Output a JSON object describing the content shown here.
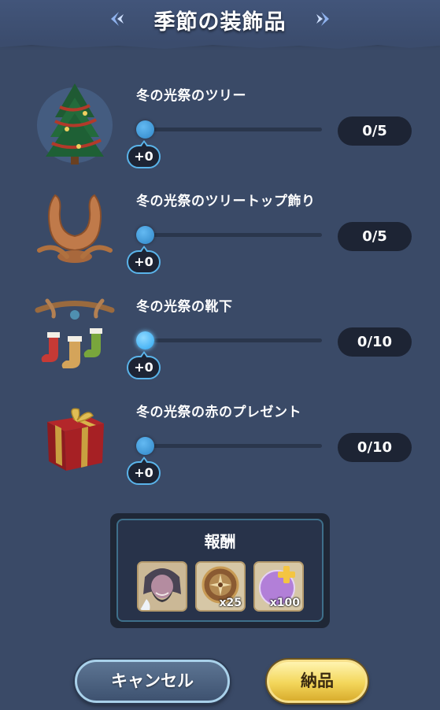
{
  "header": {
    "title": "季節の装飾品"
  },
  "items": [
    {
      "name": "冬の光祭のツリー",
      "bubble": "+0",
      "count": "0/5",
      "icon": "christmas-tree-icon"
    },
    {
      "name": "冬の光祭のツリートップ飾り",
      "bubble": "+0",
      "count": "0/5",
      "icon": "antler-ornament-icon"
    },
    {
      "name": "冬の光祭の靴下",
      "bubble": "+0",
      "count": "0/10",
      "icon": "stockings-icon"
    },
    {
      "name": "冬の光祭の赤のプレゼント",
      "bubble": "+0",
      "count": "0/10",
      "icon": "red-gift-icon"
    }
  ],
  "reward": {
    "title": "報酬",
    "items": [
      {
        "icon": "character-portrait-icon",
        "qty": ""
      },
      {
        "icon": "compass-emblem-icon",
        "qty": "x25"
      },
      {
        "icon": "moon-orb-icon",
        "qty": "x100"
      }
    ]
  },
  "buttons": {
    "cancel": "キャンセル",
    "submit": "納品"
  }
}
